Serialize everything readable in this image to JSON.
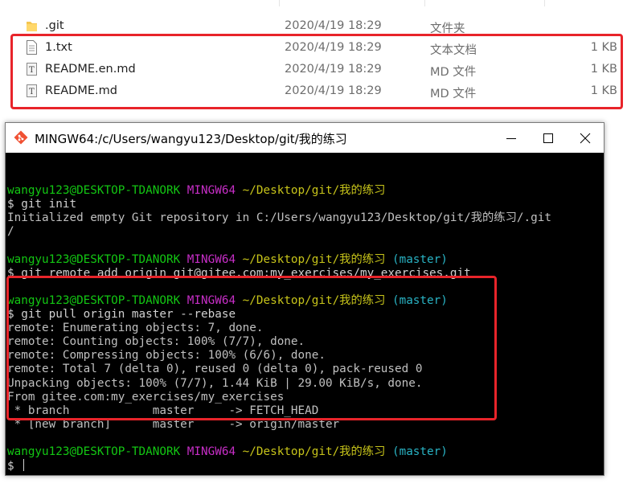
{
  "explorer": {
    "files": [
      {
        "name": ".git",
        "date": "2020/4/19 18:29",
        "type": "文件夹",
        "size": "",
        "icon": "folder-icon"
      },
      {
        "name": "1.txt",
        "date": "2020/4/19 18:29",
        "type": "文本文档",
        "size": "1 KB",
        "icon": "text-file-icon"
      },
      {
        "name": "README.en.md",
        "date": "2020/4/19 18:29",
        "type": "MD 文件",
        "size": "1 KB",
        "icon": "md-file-icon"
      },
      {
        "name": "README.md",
        "date": "2020/4/19 18:29",
        "type": "MD 文件",
        "size": "1 KB",
        "icon": "md-file-icon"
      }
    ]
  },
  "terminal": {
    "title": "MINGW64:/c/Users/wangyu123/Desktop/git/我的练习",
    "prompt_user": "wangyu123@DESKTOP-TDANORK",
    "prompt_env": "MINGW64",
    "prompt_path": "~/Desktop/git/我的练习",
    "prompt_branch": "(master)",
    "lines": {
      "cmd1": "$ git init",
      "out1a": "Initialized empty Git repository in C:/Users/wangyu123/Desktop/git/我的练习/.git",
      "out1b": "/",
      "cmd2": "$ git remote add origin git@gitee.com:my_exercises/my_exercises.git",
      "cmd3": "$ git pull origin master --rebase",
      "out3a": "remote: Enumerating objects: 7, done.",
      "out3b": "remote: Counting objects: 100% (7/7), done.",
      "out3c": "remote: Compressing objects: 100% (6/6), done.",
      "out3d": "remote: Total 7 (delta 0), reused 0 (delta 0), pack-reused 0",
      "out3e": "Unpacking objects: 100% (7/7), 1.44 KiB | 29.00 KiB/s, done.",
      "out3f": "From gitee.com:my_exercises/my_exercises",
      "out3g": " * branch            master     -> FETCH_HEAD",
      "out3h": " * [new branch]      master     -> origin/master",
      "cmd4": "$ "
    }
  },
  "colors": {
    "highlight": "#e8242a",
    "prompt_user": "#13c613",
    "prompt_env": "#c72ec7",
    "prompt_path": "#c7c41a",
    "prompt_branch": "#29b3c4"
  }
}
